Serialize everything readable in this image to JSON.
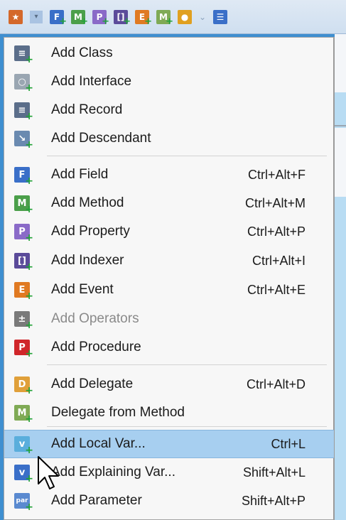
{
  "colors": {
    "field": "#3a6fc8",
    "method": "#4b9f4a",
    "property": "#8a6ac8",
    "indexer": "#5b4b9a",
    "event": "#e07a22",
    "operators": "#7a7a7a",
    "procedure": "#d0262a",
    "delegate": "#e0a03a",
    "selection": "#a7cff0"
  },
  "toolbar": {
    "icons": [
      {
        "name": "add-member-icon",
        "glyph": "★",
        "color": "#d4682a"
      },
      {
        "name": "dropdown-arrow-icon",
        "glyph": "▾",
        "color": "#a9c3e2"
      },
      {
        "name": "field-icon",
        "glyph": "F",
        "color": "#3a6fc8"
      },
      {
        "name": "method-icon",
        "glyph": "M",
        "color": "#4b9f4a"
      },
      {
        "name": "property-icon",
        "glyph": "P",
        "color": "#8a6ac8"
      },
      {
        "name": "indexer-icon",
        "glyph": "[]",
        "color": "#5b4b9a"
      },
      {
        "name": "event-icon",
        "glyph": "E",
        "color": "#e07a22"
      },
      {
        "name": "delegate-from-method-icon",
        "glyph": "M",
        "color": "#7faa55"
      },
      {
        "name": "person-icon",
        "glyph": "●",
        "color": "#e0a020"
      },
      {
        "name": "chevron-icon",
        "glyph": "⌄",
        "color": "#8da3bd"
      },
      {
        "name": "list-icon",
        "glyph": "☰",
        "color": "#3a6fc8"
      }
    ]
  },
  "menu": {
    "items": [
      {
        "label": "Add Class",
        "shortcut": "",
        "icon": "class-icon",
        "glyph": "≡",
        "color": "#5b6e8a"
      },
      {
        "label": "Add Interface",
        "shortcut": "",
        "icon": "interface-icon",
        "glyph": "○",
        "color": "#9aa6b2"
      },
      {
        "label": "Add Record",
        "shortcut": "",
        "icon": "record-icon",
        "glyph": "≡",
        "color": "#5b6e8a"
      },
      {
        "label": "Add Descendant",
        "shortcut": "",
        "icon": "descendant-icon",
        "glyph": "↘",
        "color": "#6a8ab0"
      },
      {
        "label": "Add Field",
        "shortcut": "Ctrl+Alt+F",
        "icon": "field-icon",
        "glyph": "F",
        "color": "#3a6fc8"
      },
      {
        "label": "Add Method",
        "shortcut": "Ctrl+Alt+M",
        "icon": "method-icon",
        "glyph": "M",
        "color": "#4b9f4a"
      },
      {
        "label": "Add Property",
        "shortcut": "Ctrl+Alt+P",
        "icon": "property-icon",
        "glyph": "P",
        "color": "#8a6ac8"
      },
      {
        "label": "Add Indexer",
        "shortcut": "Ctrl+Alt+I",
        "icon": "indexer-icon",
        "glyph": "[]",
        "color": "#5b4b9a"
      },
      {
        "label": "Add Event",
        "shortcut": "Ctrl+Alt+E",
        "icon": "event-icon",
        "glyph": "E",
        "color": "#e07a22"
      },
      {
        "label": "Add Operators",
        "shortcut": "",
        "icon": "operators-icon",
        "glyph": "±",
        "color": "#7a7a7a",
        "disabled": true
      },
      {
        "label": "Add Procedure",
        "shortcut": "",
        "icon": "procedure-icon",
        "glyph": "P",
        "color": "#d0262a"
      },
      {
        "label": "Add Delegate",
        "shortcut": "Ctrl+Alt+D",
        "icon": "delegate-icon",
        "glyph": "D",
        "color": "#e0a03a"
      },
      {
        "label": "Delegate from Method",
        "shortcut": "",
        "icon": "delegate-from-method-icon",
        "glyph": "M",
        "color": "#7faa55"
      },
      {
        "label": "Add Local Var...",
        "shortcut": "Ctrl+L",
        "icon": "local-var-icon",
        "glyph": "v",
        "color": "#5aaedc",
        "selected": true
      },
      {
        "label": "Add Explaining Var...",
        "shortcut": "Shift+Alt+L",
        "icon": "explaining-var-icon",
        "glyph": "v",
        "color": "#3a6fc8"
      },
      {
        "label": "Add Parameter",
        "shortcut": "Shift+Alt+P",
        "icon": "parameter-icon",
        "glyph": "par",
        "color": "#5a8ad0"
      }
    ]
  }
}
